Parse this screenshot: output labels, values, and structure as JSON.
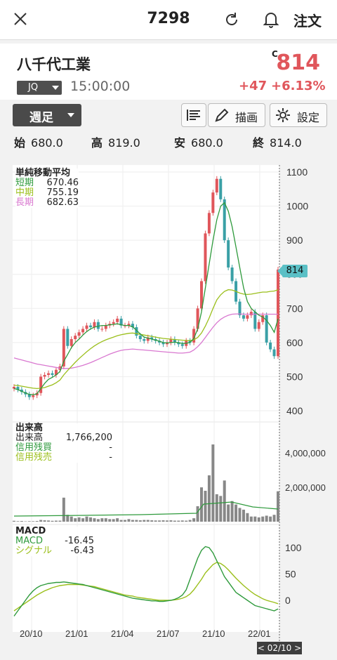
{
  "header": {
    "ticker": "7298",
    "order_label": "注文"
  },
  "quote": {
    "company": "八千代工業",
    "market": "JQ",
    "time": "15:00:00",
    "flag": "C",
    "price": "814",
    "change": "+47",
    "change_pct": "+6.13%",
    "colors": {
      "up": "#e0565b"
    }
  },
  "toolbar": {
    "period": "週足",
    "draw_label": "描画",
    "settings_label": "設定"
  },
  "ohlc": [
    {
      "label": "始",
      "value": "680.0"
    },
    {
      "label": "高",
      "value": "819.0"
    },
    {
      "label": "安",
      "value": "680.0"
    },
    {
      "label": "終",
      "value": "814.0"
    }
  ],
  "price_legend": {
    "title": "単純移動平均",
    "rows": [
      {
        "label": "短期",
        "value": "670.46",
        "color": "#2e9a3c"
      },
      {
        "label": "中期",
        "value": "755.19",
        "color": "#9bbf1b"
      },
      {
        "label": "長期",
        "value": "682.63",
        "color": "#d978d0"
      }
    ]
  },
  "price_axis": [
    "1100",
    "1000",
    "900",
    "800",
    "700",
    "600",
    "500",
    "400"
  ],
  "last_price_badge": "814",
  "volume_legend": {
    "title": "出来高",
    "rows": [
      {
        "label": "出来高",
        "value": "1,766,200"
      },
      {
        "label": "信用残買",
        "value": "-"
      },
      {
        "label": "信用残売",
        "value": "-"
      }
    ]
  },
  "volume_axis": [
    "4,000,000",
    "2,000,000"
  ],
  "macd_legend": {
    "title": "MACD",
    "rows": [
      {
        "label": "MACD",
        "value": "-16.45",
        "color": "#2e9a3c"
      },
      {
        "label": "シグナル",
        "value": "-6.43",
        "color": "#9bbf1b"
      }
    ]
  },
  "macd_axis": [
    "100",
    "50",
    "0"
  ],
  "x_axis": [
    "20/10",
    "21/01",
    "21/04",
    "21/07",
    "21/10",
    "22/01"
  ],
  "cursor_date": "< 02/10 >",
  "chart_data": {
    "type": "candlestick",
    "x_ticks": [
      "20/10",
      "21/01",
      "21/04",
      "21/07",
      "21/10",
      "22/01"
    ],
    "ylim": [
      400,
      1100
    ],
    "closes": [
      470,
      462,
      455,
      448,
      440,
      445,
      452,
      500,
      505,
      510,
      505,
      520,
      530,
      640,
      590,
      610,
      620,
      630,
      640,
      650,
      645,
      660,
      640,
      640,
      650,
      655,
      660,
      670,
      650,
      650,
      655,
      645,
      620,
      610,
      605,
      615,
      610,
      605,
      600,
      595,
      600,
      610,
      600,
      595,
      590,
      605,
      600,
      640,
      700,
      780,
      920,
      980,
      1040,
      1080,
      1020,
      900,
      820,
      780,
      720,
      680,
      670,
      680,
      690,
      640,
      660,
      680,
      600,
      580,
      560,
      814
    ],
    "sma_short": [
      465,
      462,
      457,
      452,
      448,
      447,
      450,
      465,
      480,
      492,
      498,
      505,
      515,
      545,
      565,
      585,
      600,
      610,
      622,
      632,
      640,
      645,
      648,
      650,
      650,
      652,
      653,
      655,
      652,
      650,
      650,
      646,
      636,
      625,
      616,
      613,
      610,
      607,
      604,
      600,
      599,
      600,
      601,
      600,
      597,
      598,
      600,
      612,
      640,
      690,
      760,
      830,
      900,
      960,
      1000,
      1010,
      985,
      940,
      880,
      820,
      760,
      720,
      700,
      690,
      680,
      675,
      665,
      650,
      630,
      670
    ],
    "sma_mid": [
      475,
      474,
      472,
      470,
      468,
      466,
      465,
      466,
      468,
      472,
      476,
      482,
      490,
      505,
      518,
      530,
      542,
      553,
      563,
      573,
      582,
      590,
      597,
      603,
      608,
      612,
      616,
      620,
      623,
      625,
      627,
      628,
      626,
      624,
      622,
      620,
      618,
      616,
      614,
      612,
      611,
      610,
      609,
      608,
      607,
      606,
      606,
      608,
      615,
      628,
      648,
      672,
      700,
      725,
      740,
      750,
      755,
      754,
      750,
      745,
      742,
      741,
      742,
      744,
      746,
      748,
      748,
      750,
      751,
      755
    ],
    "sma_long": [
      555,
      552,
      549,
      546,
      543,
      540,
      537,
      535,
      533,
      531,
      529,
      527,
      525,
      524,
      524,
      525,
      527,
      530,
      533,
      537,
      541,
      546,
      551,
      556,
      561,
      566,
      570,
      574,
      577,
      579,
      580,
      581,
      580,
      579,
      578,
      577,
      576,
      575,
      574,
      573,
      572,
      571,
      570,
      569,
      569,
      570,
      572,
      578,
      588,
      600,
      615,
      630,
      645,
      658,
      668,
      675,
      680,
      683,
      684,
      684,
      683,
      683,
      683,
      683,
      683,
      683,
      683,
      683,
      683,
      683
    ],
    "volume_m": [
      0.05,
      0.03,
      0.04,
      0.02,
      0.03,
      0.03,
      0.04,
      0.1,
      0.08,
      0.07,
      0.05,
      0.06,
      0.06,
      1.4,
      0.4,
      0.3,
      0.2,
      0.25,
      0.2,
      0.3,
      0.25,
      0.2,
      0.15,
      0.2,
      0.2,
      0.15,
      0.15,
      0.2,
      0.1,
      0.1,
      0.15,
      0.1,
      0.1,
      0.08,
      0.1,
      0.1,
      0.08,
      0.07,
      0.07,
      0.08,
      0.07,
      0.08,
      0.06,
      0.06,
      0.07,
      0.06,
      0.1,
      0.2,
      0.9,
      2.0,
      1.8,
      2.7,
      4.5,
      1.6,
      1.5,
      2.4,
      1.0,
      1.2,
      1.0,
      0.8,
      0.7,
      0.5,
      0.3,
      0.3,
      0.25,
      0.3,
      0.35,
      0.3,
      0.4,
      1.77
    ],
    "macd": [
      -30,
      -20,
      -10,
      0,
      10,
      18,
      24,
      28,
      30,
      32,
      33,
      34,
      34,
      35,
      34,
      33,
      32,
      31,
      30,
      28,
      26,
      24,
      22,
      20,
      18,
      16,
      14,
      12,
      10,
      8,
      6,
      4,
      3,
      2,
      1,
      0,
      -1,
      -1,
      -2,
      -2,
      -1,
      0,
      2,
      5,
      10,
      20,
      40,
      60,
      80,
      95,
      102,
      100,
      90,
      75,
      60,
      45,
      35,
      25,
      15,
      10,
      5,
      0,
      -5,
      -10,
      -12,
      -14,
      -16,
      -18,
      -20,
      -16.45
    ],
    "signal": [
      -20,
      -15,
      -10,
      -5,
      0,
      5,
      10,
      14,
      18,
      21,
      24,
      26,
      28,
      29,
      30,
      30,
      30,
      30,
      29,
      28,
      27,
      26,
      24,
      22,
      20,
      18,
      16,
      14,
      12,
      10,
      9,
      8,
      6,
      5,
      4,
      3,
      2,
      1,
      0,
      0,
      0,
      0,
      1,
      2,
      4,
      7,
      12,
      20,
      30,
      40,
      52,
      60,
      68,
      72,
      70,
      65,
      58,
      50,
      42,
      35,
      28,
      22,
      16,
      11,
      7,
      3,
      0,
      -2,
      -4,
      -6.43
    ]
  }
}
